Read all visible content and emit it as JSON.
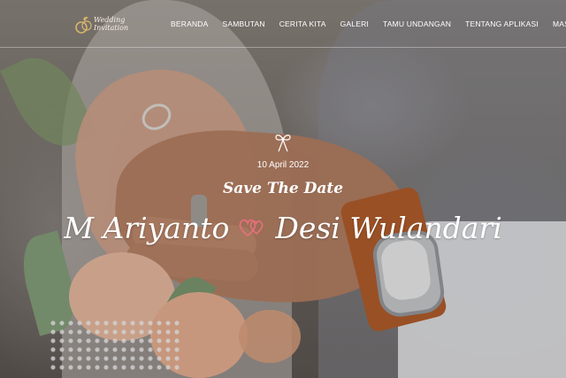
{
  "brand": {
    "logo_line1": "Wedding",
    "logo_line2": "Invitation"
  },
  "nav": [
    {
      "label": "BERANDA"
    },
    {
      "label": "SAMBUTAN"
    },
    {
      "label": "CERITA KITA"
    },
    {
      "label": "GALERI"
    },
    {
      "label": "TAMU UNDANGAN"
    },
    {
      "label": "TENTANG APLIKASI"
    },
    {
      "label": "MASUK"
    }
  ],
  "hero": {
    "date": "10 April 2022",
    "tagline": "Save The Date",
    "groom": "M Ariyanto",
    "bride": "Desi Wulandari"
  },
  "icons": {
    "ornament": "ribbon-bow-icon",
    "couple": "double-heart-icon"
  },
  "colors": {
    "nav_text": "#ffffff",
    "heart_accent": "#e2707a",
    "logo_gold": "#d8b46a"
  }
}
